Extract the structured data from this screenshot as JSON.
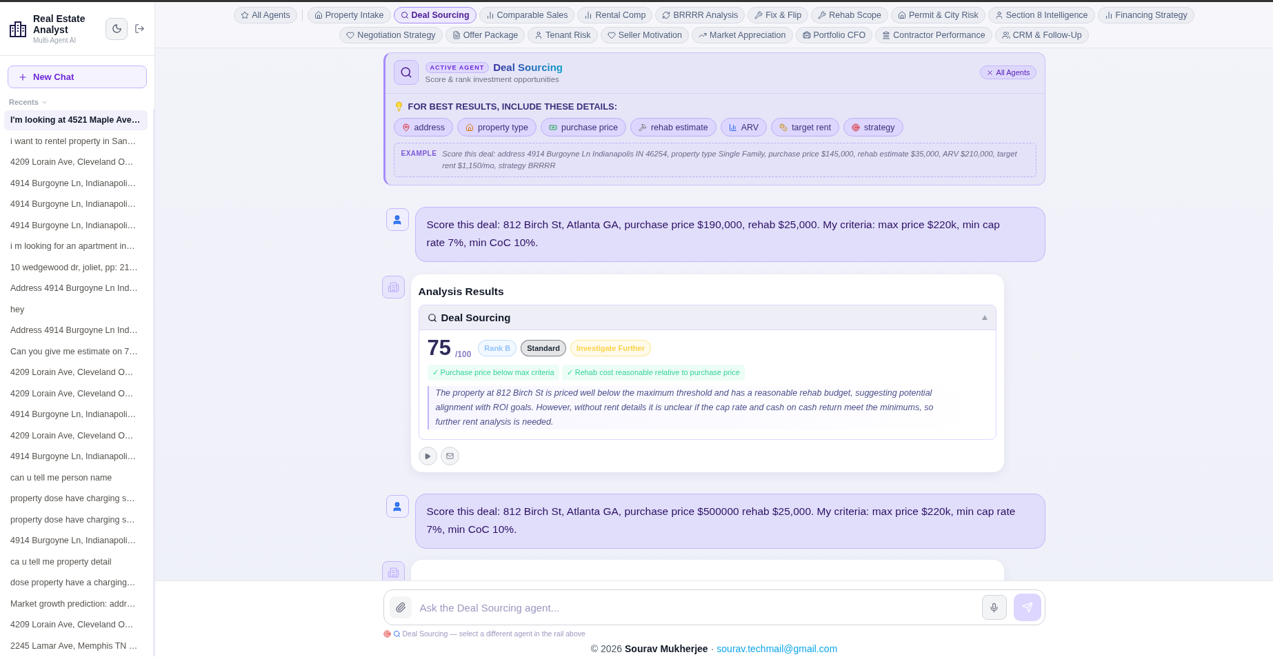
{
  "sidebar": {
    "app_title": "Real Estate Analyst",
    "app_subtitle": "Multi-Agent AI",
    "new_chat": "New Chat",
    "recents_label": "Recents",
    "items": [
      {
        "label": "I'm looking at 4521 Maple Ave…",
        "selected": true
      },
      {
        "label": "i want to rentel property in San…",
        "selected": false
      },
      {
        "label": "4209 Lorain Ave, Cleveland O…",
        "selected": false
      },
      {
        "label": "4914 Burgoyne Ln, Indianapoli…",
        "selected": false
      },
      {
        "label": "4914 Burgoyne Ln, Indianapoli…",
        "selected": false
      },
      {
        "label": "4914 Burgoyne Ln, Indianapoli…",
        "selected": false
      },
      {
        "label": "i m looking for an apartment in…",
        "selected": false
      },
      {
        "label": "10 wedgewood dr, joliet, pp: 21…",
        "selected": false
      },
      {
        "label": "Address 4914 Burgoyne Ln Ind…",
        "selected": false
      },
      {
        "label": "hey",
        "selected": false
      },
      {
        "label": "Address 4914 Burgoyne Ln Ind…",
        "selected": false
      },
      {
        "label": "Can you give me estimate on 7…",
        "selected": false
      },
      {
        "label": "4209 Lorain Ave, Cleveland O…",
        "selected": false
      },
      {
        "label": "4209 Lorain Ave, Cleveland O…",
        "selected": false
      },
      {
        "label": "4914 Burgoyne Ln, Indianapoli…",
        "selected": false
      },
      {
        "label": "4209 Lorain Ave, Cleveland O…",
        "selected": false
      },
      {
        "label": "4914 Burgoyne Ln, Indianapoli…",
        "selected": false
      },
      {
        "label": "can u tell me person name",
        "selected": false
      },
      {
        "label": "property dose have charging s…",
        "selected": false
      },
      {
        "label": "property dose have charging s…",
        "selected": false
      },
      {
        "label": "4914 Burgoyne Ln, Indianapoli…",
        "selected": false
      },
      {
        "label": "ca u tell me property detail",
        "selected": false
      },
      {
        "label": "dose property have a charging…",
        "selected": false
      },
      {
        "label": "Market growth prediction: addr…",
        "selected": false
      },
      {
        "label": "4209 Lorain Ave, Cleveland O…",
        "selected": false
      },
      {
        "label": "2245 Lamar Ave, Memphis TN …",
        "selected": false
      }
    ]
  },
  "agent_rail": {
    "rows": [
      {
        "items": [
          {
            "label": "All Agents",
            "selected": false
          },
          {
            "label": "Property Intake",
            "selected": false
          },
          {
            "label": "Deal Sourcing",
            "selected": true
          },
          {
            "label": "Comparable Sales",
            "selected": false
          },
          {
            "label": "Rental Comp",
            "selected": false
          },
          {
            "label": "BRRRR Analysis",
            "selected": false
          },
          {
            "label": "Fix & Flip",
            "selected": false
          },
          {
            "label": "Rehab Scope",
            "selected": false
          },
          {
            "label": "Permit & City Risk",
            "selected": false
          },
          {
            "label": "Section 8 Intelligence",
            "selected": false
          },
          {
            "label": "Financing Strategy",
            "selected": false
          }
        ]
      },
      {
        "items": [
          {
            "label": "Negotiation Strategy",
            "selected": false
          },
          {
            "label": "Offer Package",
            "selected": false
          },
          {
            "label": "Tenant Risk",
            "selected": false
          },
          {
            "label": "Seller Motivation",
            "selected": false
          },
          {
            "label": "Market Appreciation",
            "selected": false
          },
          {
            "label": "Portfolio CFO",
            "selected": false
          },
          {
            "label": "Contractor Performance",
            "selected": false
          },
          {
            "label": "CRM & Follow-Up",
            "selected": false
          }
        ]
      }
    ]
  },
  "active_agent": {
    "badge": "ACTIVE AGENT",
    "name": "Deal Sourcing",
    "description": "Score & rank investment opportunities",
    "close_label": "All Agents",
    "tip_heading": "FOR BEST RESULTS, INCLUDE THESE DETAILS:",
    "fields": [
      "address",
      "property type",
      "purchase price",
      "rehab estimate",
      "ARV",
      "target rent",
      "strategy"
    ],
    "example_label": "EXAMPLE",
    "example_text": "Score this deal: address 4914 Burgoyne Ln Indianapolis IN 46254, property type Single Family, purchase price $145,000, rehab estimate $35,000, ARV $210,000, target rent $1,150/mo, strategy BRRRR"
  },
  "messages": [
    {
      "kind": "user",
      "text": "Score this deal: 812 Birch St, Atlanta GA, purchase price $190,000, rehab $25,000. My criteria: max price $220k, min cap rate 7%, min CoC 10%."
    },
    {
      "kind": "result",
      "title": "Analysis Results",
      "section": {
        "title": "Deal Sourcing",
        "expanded": true,
        "score": "75",
        "score_max": "/100",
        "badges": [
          {
            "label": "Rank B",
            "color": "#93c5fd"
          },
          {
            "label": "Standard",
            "color": "#1f2937"
          },
          {
            "label": "Investigate Further",
            "color": "#fcd34d"
          }
        ],
        "checks": [
          "✓ Purchase price below max criteria",
          "✓ Rehab cost reasonable relative to purchase price"
        ],
        "summary": "The property at 812 Birch St is priced well below the maximum threshold and has a reasonable rehab budget, suggesting potential alignment with ROI goals. However, without rent details it is unclear if the cap rate and cash on cash return meet the minimums, so further rent analysis is needed."
      }
    },
    {
      "kind": "user",
      "text": "Score this deal: 812 Birch St, Atlanta GA, purchase price $500000 rehab $25,000. My criteria: max price $220k, min cap rate 7%, min CoC 10%."
    },
    {
      "kind": "result"
    }
  ],
  "composer": {
    "placeholder": "Ask the Deal Sourcing agent...",
    "hint": "Deal Sourcing — select a different agent in the rail above"
  },
  "footer": {
    "copyright": "© 2026",
    "author": "Sourav Mukherjee",
    "separator": "·",
    "email": "sourav.techmail@gmail.com"
  }
}
